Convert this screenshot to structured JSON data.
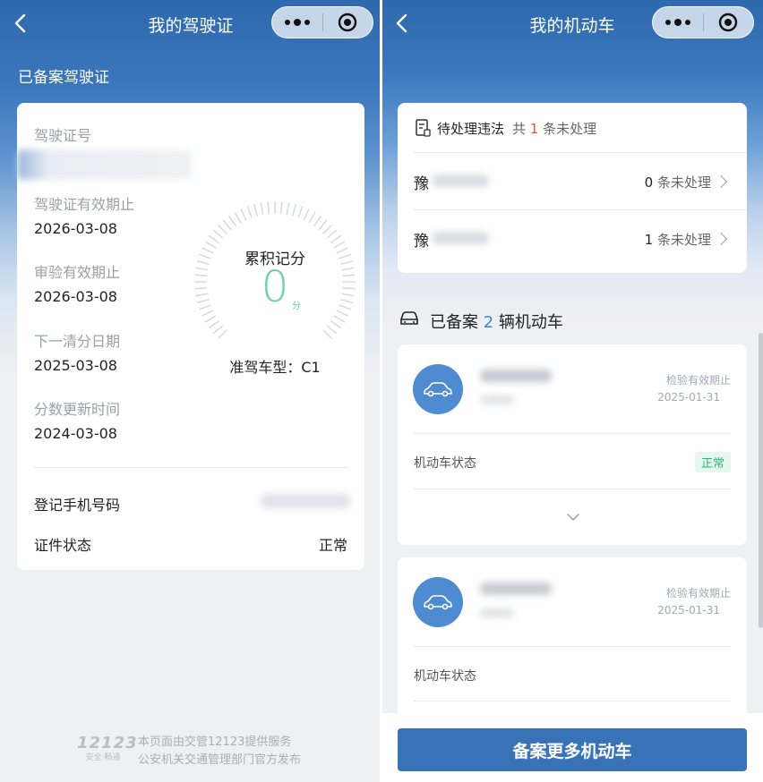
{
  "left": {
    "nav": {
      "title": "我的驾驶证"
    },
    "section_heading": "已备案驾驶证",
    "license": {
      "number_label": "驾驶证号",
      "validity_label": "驾驶证有效期止",
      "validity_value": "2026-03-08",
      "audit_label": "审验有效期止",
      "audit_value": "2026-03-08",
      "clear_label": "下一清分日期",
      "clear_value": "2025-03-08",
      "update_label": "分数更新时间",
      "update_value": "2024-03-08",
      "score_title": "累积记分",
      "score_value": "0",
      "score_unit": "分",
      "vehicle_type": "准驾车型：C1",
      "phone_label": "登记手机号码",
      "status_label": "证件状态",
      "status_value": "正常"
    },
    "footer": {
      "logo_text": "12123",
      "logo_slogan": "安全·畅通",
      "line1": "本页面由交管12123提供服务",
      "line2": "公安机关交通管理部门官方发布"
    }
  },
  "right": {
    "nav": {
      "title": "我的机动车"
    },
    "violations": {
      "title": "待处理违法",
      "summary_prefix": "共",
      "summary_count": "1",
      "summary_suffix": "条未处理",
      "rows": [
        {
          "plate_prefix": "豫",
          "count": "0",
          "suffix": "条未处理"
        },
        {
          "plate_prefix": "豫",
          "count": "1",
          "suffix": "条未处理"
        }
      ]
    },
    "vehicles_heading": {
      "prefix": "已备案",
      "count": "2",
      "suffix": "辆机动车"
    },
    "vehicles": [
      {
        "inspect_label": "检验有效期止",
        "inspect_value": "2025-01-31",
        "status_label": "机动车状态",
        "status_value": "正常"
      },
      {
        "inspect_label": "检验有效期止",
        "inspect_value": "2025-01-31",
        "status_label": "机动车状态"
      }
    ],
    "register_button": "备案更多机动车"
  },
  "colors": {
    "primary": "#3a72b8",
    "score_green": "#6ed0a7",
    "accent_red": "#e0562f",
    "accent_blue": "#3a86d8"
  }
}
